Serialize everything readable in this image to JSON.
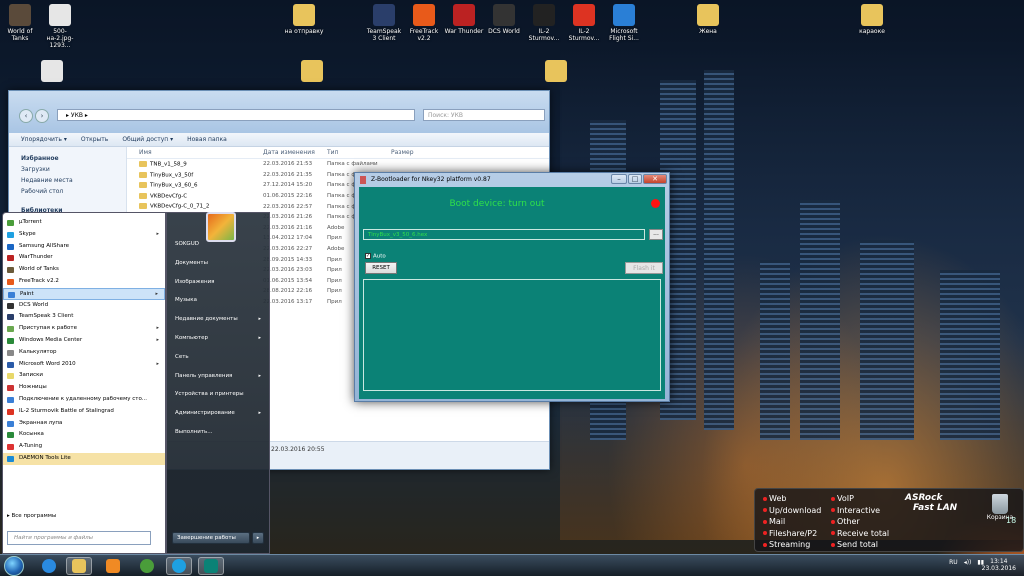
{
  "desktop": {
    "icons": [
      {
        "label": "World of Tanks",
        "x": "",
        "color": "#5a4a3a"
      },
      {
        "label": "500-на-2.jpg-1293...",
        "color": "#e6e6e6"
      },
      {
        "label": "на отправку",
        "color": "#e8c45c"
      },
      {
        "label": "TeamSpeak 3 Client",
        "color": "#2a3e6a"
      },
      {
        "label": "FreeTrack v2.2",
        "color": "#e85a1a"
      },
      {
        "label": "War Thunder",
        "color": "#b22"
      },
      {
        "label": "DCS World",
        "color": "#333"
      },
      {
        "label": "IL-2 Sturmov...",
        "color": "#222"
      },
      {
        "label": "IL-2 Sturmov...",
        "color": "#d32"
      },
      {
        "label": "Microsoft Flight Si...",
        "color": "#2a7fd6"
      },
      {
        "label": "Жена",
        "color": "#e8c45c"
      },
      {
        "label": "караоке",
        "color": "#e8c45c"
      }
    ]
  },
  "explorer": {
    "address": "▸ УКВ ▸",
    "search_placeholder": "Поиск: УКВ",
    "toolbar": {
      "organize": "Упорядочить ▾",
      "open": "Открыть",
      "share": "Общий доступ ▾",
      "new_folder": "Новая папка"
    },
    "sidebar": {
      "favorites": "Избранное",
      "downloads": "Загрузки",
      "recent": "Недавние места",
      "desktop": "Рабочий стол",
      "libraries": "Библиотеки"
    },
    "columns": {
      "name": "Имя",
      "date": "Дата изменения",
      "type": "Тип",
      "size": "Размер"
    },
    "rows": [
      {
        "name": "TNB_v1_58_9",
        "date": "22.03.2016 21:53",
        "type": "Папка с файлами"
      },
      {
        "name": "TinyBux_v3_50f",
        "date": "22.03.2016 21:35",
        "type": "Папка с файлами"
      },
      {
        "name": "TinyBux_v3_60_6",
        "date": "27.12.2014 15:20",
        "type": "Папка с файлами"
      },
      {
        "name": "VKBDevCfg-C",
        "date": "01.06.2015 22:16",
        "type": "Папка с файлами"
      },
      {
        "name": "VKBDevCfg-C_0_71_2",
        "date": "22.03.2016 22:57",
        "type": "Папка с файлами"
      },
      {
        "name": "",
        "date": "22.03.2016 21:26",
        "type": "Папка с файлами"
      },
      {
        "name": "",
        "date": "22.03.2016 21:16",
        "type": "Adobe"
      },
      {
        "name": "",
        "date": "13.04.2012 17:04",
        "type": "Прил"
      },
      {
        "name": "",
        "date": "22.03.2016 22:27",
        "type": "Adobe"
      },
      {
        "name": "",
        "date": "28.09.2015 14:33",
        "type": "Прил"
      },
      {
        "name": "",
        "date": "22.03.2016 23:03",
        "type": "Прил"
      },
      {
        "name": "",
        "date": "01.06.2015 13:54",
        "type": "Прил"
      },
      {
        "name": "",
        "date": "28.08.2012 22:16",
        "type": "Прил"
      },
      {
        "name": "",
        "date": "22.03.2016 13:17",
        "type": "Прил"
      }
    ],
    "footer_date": "22.03.2016 20:55"
  },
  "start_menu": {
    "items": [
      {
        "label": "µTorrent",
        "color": "#4a9d3a",
        "arrow": ""
      },
      {
        "label": "Skype",
        "color": "#1ea0e1",
        "arrow": "▸"
      },
      {
        "label": "Samsung AllShare",
        "color": "#1a66c4",
        "arrow": ""
      },
      {
        "label": "WarThunder",
        "color": "#b22",
        "arrow": ""
      },
      {
        "label": "World of Tanks",
        "color": "#6b5b3a",
        "arrow": ""
      },
      {
        "label": "FreeTrack v2.2",
        "color": "#e85a1a",
        "arrow": ""
      },
      {
        "label": "Paint",
        "color": "#3a7fd6",
        "arrow": "▸"
      },
      {
        "label": "DCS World",
        "color": "#333",
        "arrow": ""
      },
      {
        "label": "TeamSpeak 3 Client",
        "color": "#2a3e6a",
        "arrow": ""
      },
      {
        "label": "Приступая к работе",
        "color": "#6aa84f",
        "arrow": "▸"
      },
      {
        "label": "Windows Media Center",
        "color": "#2a8a3a",
        "arrow": "▸"
      },
      {
        "label": "Калькулятор",
        "color": "#888",
        "arrow": ""
      },
      {
        "label": "Microsoft Word 2010",
        "color": "#2a5aa8",
        "arrow": "▸"
      },
      {
        "label": "Записки",
        "color": "#e8d86a",
        "arrow": ""
      },
      {
        "label": "Ножницы",
        "color": "#c33",
        "arrow": ""
      },
      {
        "label": "Подключение к удаленному рабочему сто...",
        "color": "#3a7fd6",
        "arrow": ""
      },
      {
        "label": "IL-2 Sturmovik Battle of Stalingrad",
        "color": "#d32",
        "arrow": ""
      },
      {
        "label": "Экранная лупа",
        "color": "#3a7fd6",
        "arrow": ""
      },
      {
        "label": "Косынка",
        "color": "#2a8a3a",
        "arrow": ""
      },
      {
        "label": "A-Tuning",
        "color": "#d33",
        "arrow": ""
      },
      {
        "label": "DAEMON Tools Lite",
        "color": "#1a8ad6",
        "arrow": ""
      }
    ],
    "all_programs": "▸  Все программы",
    "search_placeholder": "Найти программы и файлы",
    "right_items": [
      {
        "label": "SOKGUD",
        "arrow": ""
      },
      {
        "label": "Документы",
        "arrow": ""
      },
      {
        "label": "Изображения",
        "arrow": ""
      },
      {
        "label": "Музыка",
        "arrow": ""
      },
      {
        "label": "Недавние документы",
        "arrow": "▸"
      },
      {
        "label": "Компьютер",
        "arrow": "▸"
      },
      {
        "label": "Сеть",
        "arrow": ""
      },
      {
        "label": "Панель управления",
        "arrow": "▸"
      },
      {
        "label": "Устройства и принтеры",
        "arrow": ""
      },
      {
        "label": "Администрирование",
        "arrow": "▸"
      },
      {
        "label": "Выполнить...",
        "arrow": ""
      }
    ],
    "shutdown": "Завершение работы",
    "shutdown_arrow": "▸"
  },
  "bootloader": {
    "title": "Z-Bootloader for Nkey32 platform v0.87",
    "status": "Boot device: turn out",
    "path": "TinyBux_v3_50_6.hex",
    "browse": "...",
    "auto_label": "Auto",
    "auto_checked": "✓",
    "reset": "RESET",
    "flash": "Flash it",
    "min": "–",
    "max": "□",
    "close": "✕"
  },
  "asrock": {
    "rows": [
      [
        "Web",
        "VoIP"
      ],
      [
        "Up/download",
        "Interactive"
      ],
      [
        "Mail",
        "Other"
      ],
      [
        "Fileshare/P2",
        "Receive total"
      ],
      [
        "Streaming",
        "Send total"
      ]
    ],
    "logo": "ASRock",
    "logo2": "Fast LAN",
    "number": "18"
  },
  "recycle_bin": {
    "label": "Корзина"
  },
  "taskbar": {
    "tray_lang": "RU",
    "time": "13:14",
    "date": "23.03.2016"
  }
}
